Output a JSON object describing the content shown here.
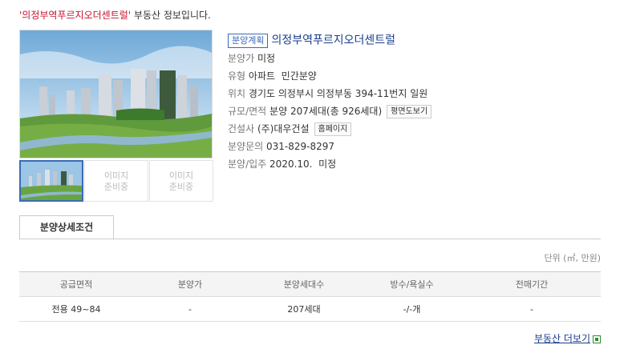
{
  "headline": {
    "name_quoted": "'의정부역푸르지오더센트럴'",
    "suffix": " 부동산 정보입니다."
  },
  "thumbs": [
    {
      "placeholder": "이미지\n준비중"
    },
    {
      "placeholder": "이미지\n준비중"
    }
  ],
  "info": {
    "badge": "분양계획",
    "title": "의정부역푸르지오더센트럴",
    "price_label": "분양가",
    "price_value": "미정",
    "type_label": "유형",
    "type_value": "아파트  민간분양",
    "location_label": "위치",
    "location_value": "경기도 의정부시 의정부동 394-11번지 일원",
    "scale_label": "규모/면적",
    "scale_value": "분양 207세대(총 926세대)",
    "floorplan_button": "평면도보기",
    "builder_label": "건설사",
    "builder_value": "(주)대우건설",
    "homepage_button": "홈페이지",
    "inquiry_label": "분양문의",
    "inquiry_value": "031-829-8297",
    "schedule_label": "분양/입주",
    "schedule_value": "2020.10.  미정"
  },
  "tab": {
    "label": "분양상세조건"
  },
  "unit_note": "단위 (㎡, 만원)",
  "table": {
    "headers": [
      "공급면적",
      "분양가",
      "분양세대수",
      "방수/욕실수",
      "전매기간"
    ],
    "rows": [
      [
        "전용 49~84",
        "-",
        "207세대",
        "-/-개",
        "-"
      ]
    ]
  },
  "more_link": "부동산 더보기"
}
